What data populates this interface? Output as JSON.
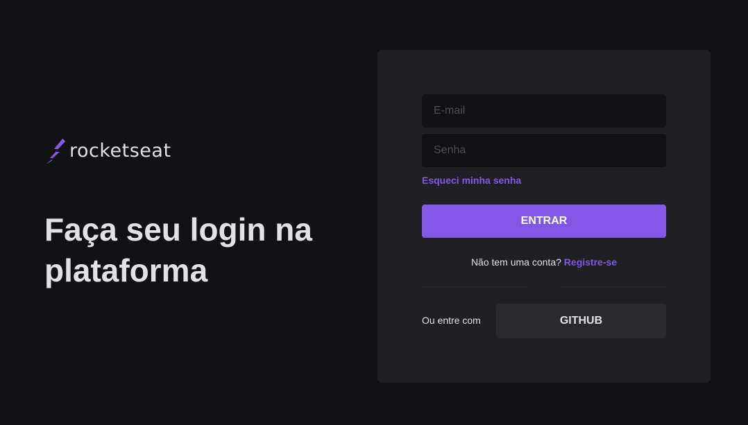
{
  "brand": {
    "name": "rocketseat",
    "logo_icon": "rocket-bolt-icon",
    "accent_color": "#8257e5"
  },
  "hero": {
    "headline": "Faça seu login na plataforma"
  },
  "login_form": {
    "email": {
      "value": "",
      "placeholder": "E-mail"
    },
    "password": {
      "value": "",
      "placeholder": "Senha"
    },
    "forgot_password_label": "Esqueci minha senha",
    "submit_label": "ENTRAR",
    "signup_prompt": "Não tem uma conta?",
    "signup_link_label": "Registre-se",
    "alt_login_label": "Ou entre com",
    "github_label": "GITHUB"
  },
  "colors": {
    "background": "#121214",
    "card": "#202024",
    "input": "#121214",
    "secondary_button": "#29292e",
    "text": "#e1e1e6",
    "accent": "#8257e5"
  }
}
